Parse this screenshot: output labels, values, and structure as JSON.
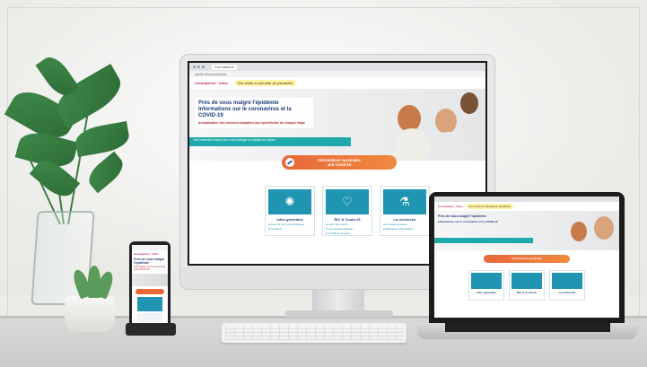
{
  "browser": {
    "tab_label": "Coronavirus",
    "url": "sante.fr/coronavirus"
  },
  "site": {
    "left_link": "Coronavirus : infos",
    "right_pill": "Vos droits en période de pandémie"
  },
  "hero": {
    "title_line1": "Près de vous malgré l'épidémie",
    "title_line2": "Informations sur le coronavirus et la COVID-19",
    "subtitle": "Actualisation des mesures adaptées aux spécificités de chaque étape",
    "band": "Tout l'essentiel à savoir pour vous protéger et protéger les autres"
  },
  "cta": {
    "label_line1": "Informations vaccinales",
    "label_line2": "anti Covid-19"
  },
  "cards": [
    {
      "icon": "virus-icon",
      "glyph": "✺",
      "title": "Infos générales",
      "lines": [
        "En quoi le virus est dangereux",
        "En pratique"
      ]
    },
    {
      "icon": "shield-heart-icon",
      "glyph": "♡",
      "title": "RIC & Covid-19",
      "lines": [
        "Ce qu'il faut savoir",
        "Communiqués officiels",
        "Les chiffres du suivi"
      ]
    },
    {
      "icon": "microscope-icon",
      "glyph": "⚗",
      "title": "La recherche",
      "lines": [
        "Les essais cliniques",
        "Publications scientifiques"
      ]
    }
  ],
  "colors": {
    "brand": "#c01a55",
    "navy": "#1d3c7a",
    "teal": "#1fa9ac",
    "orange": "#e8683a",
    "card_blue": "#1f95b1"
  }
}
